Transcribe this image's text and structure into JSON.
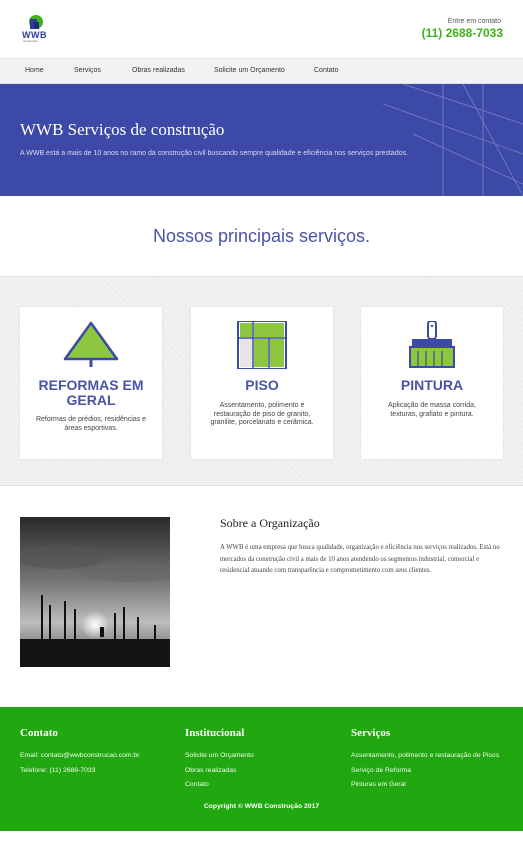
{
  "header": {
    "logo_text": "WWB",
    "logo_subtext": "construção",
    "contact_label": "Entre em contato",
    "contact_phone": "(11) 2688-7033"
  },
  "nav": {
    "items": [
      {
        "label": "Home"
      },
      {
        "label": "Serviços"
      },
      {
        "label": "Obras realizadas"
      },
      {
        "label": "Solicite um Orçamento"
      },
      {
        "label": "Contato"
      }
    ]
  },
  "hero": {
    "title": "WWB Serviços de construção",
    "subtitle": "A WWB está a mais de 10 anos no ramo da construção civil buscando sempre qualidade e eficiência nos serviços prestados."
  },
  "services": {
    "title": "Nossos principais serviços.",
    "cards": [
      {
        "title": "REFORMAS EM GERAL",
        "description": "Reformas de prédios, residências e áreas esportivas.",
        "icon": "trowel-icon"
      },
      {
        "title": "PISO",
        "description": "Assentamento, polimento e restauração de piso de granito, granilite, porcelanato e cerâmica.",
        "icon": "tiles-icon"
      },
      {
        "title": "PINTURA",
        "description": "Aplicação de massa corrida, texturas, grafiato e pintura.",
        "icon": "paint-brush-icon"
      }
    ]
  },
  "about": {
    "title": "Sobre a Organização",
    "text": "A WWB é uma empresa que busca qualidade, organização e eficiência nos serviços realizados. Está no mercados da construção civil a mais de 10 anos atendendo os segmentos industrial, comercial e residencial atuando com transparência e comprometimento com seus clientes."
  },
  "footer": {
    "contact": {
      "title": "Contato",
      "email": "Email: contato@wwbconstrucao.com.br",
      "phone": "Telefone: (11) 2688-7033"
    },
    "institutional": {
      "title": "Institucional",
      "links": [
        "Solicite um Orçamento",
        "Obras realizadas",
        "Contato"
      ]
    },
    "services": {
      "title": "Serviços",
      "links": [
        "Assentamento, polimento e restauração de Pisos",
        "Serviço de Reforma",
        "Pinturas em Geral"
      ]
    },
    "copyright": "Copyright © WWB Construção 2017"
  },
  "colors": {
    "brand_blue": "#3c49a6",
    "title_blue": "#4b53a6",
    "brand_green": "#21a70f",
    "phone_green": "#3cb11a"
  }
}
